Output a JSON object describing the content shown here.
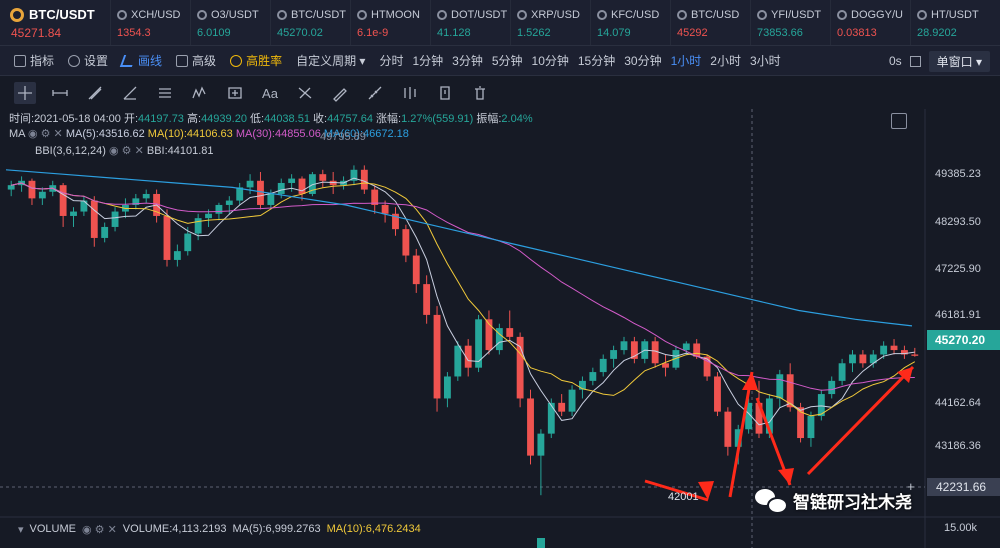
{
  "ticker": {
    "main": {
      "symbol": "BTC/USDT",
      "price": "45271.84"
    },
    "items": [
      {
        "symbol": "XCH/USD",
        "price": "1354.3",
        "dir": "down"
      },
      {
        "symbol": "O3/USDT",
        "price": "6.0109",
        "dir": "up"
      },
      {
        "symbol": "BTC/USDT",
        "price": "45270.02",
        "dir": "up"
      },
      {
        "symbol": "HTMOON",
        "price": "6.1e-9",
        "dir": "down"
      },
      {
        "symbol": "DOT/USDT",
        "price": "41.128",
        "dir": "up"
      },
      {
        "symbol": "XRP/USD",
        "price": "1.5262",
        "dir": "up"
      },
      {
        "symbol": "KFC/USD",
        "price": "14.079",
        "dir": "up"
      },
      {
        "symbol": "BTC/USD",
        "price": "45292",
        "dir": "down"
      },
      {
        "symbol": "YFI/USDT",
        "price": "73853.66",
        "dir": "up"
      },
      {
        "symbol": "DOGGY/U",
        "price": "0.03813",
        "dir": "down"
      },
      {
        "symbol": "HT/USDT",
        "price": "28.9202",
        "dir": "up"
      }
    ]
  },
  "toolbar": {
    "indicators": "指标",
    "settings": "设置",
    "draw": "画线",
    "advanced": "高级",
    "winrate": "高胜率",
    "custom_period": "自定义周期 ▾",
    "timeframes": [
      "分时",
      "1分钟",
      "3分钟",
      "5分钟",
      "10分钟",
      "15分钟",
      "30分钟",
      "1小时",
      "2小时",
      "3小时"
    ],
    "active_timeframe": "1小时",
    "zero_s": "0s",
    "window_select": "单窗口 ▾"
  },
  "drawtools": [
    "crosshair",
    "hline",
    "ray",
    "trend",
    "channel",
    "wave",
    "rect",
    "text",
    "fib",
    "brush",
    "measure",
    "pattern",
    "clock",
    "delete"
  ],
  "info": {
    "line1": {
      "time_label": "时间:",
      "time": "2021-05-18 04:00",
      "open_label": "开:",
      "open": "44197.73",
      "high_label": "高:",
      "high": "44939.20",
      "low_label": "低:",
      "low": "44038.51",
      "close_label": "收:",
      "close": "44757.64",
      "chg_label": "涨幅:",
      "chg": "1.27%(559.91)",
      "amp_label": "振幅:",
      "amp": "2.04%"
    },
    "ma_line": {
      "name": "MA",
      "ma5": "MA(5):43516.62",
      "ma10": "MA(10):44106.63",
      "ma30": "MA(30):44855.06",
      "ma60": "MA(60):46672.18"
    },
    "bbi_line": {
      "name": "BBI(3,6,12,24)",
      "bbi": "BBI:44101.81"
    },
    "overlay_high_label": "49795.89",
    "low_label": "42001"
  },
  "price_axis": {
    "ticks": [
      "49385.23",
      "48293.50",
      "47225.90",
      "46181.91",
      "44162.64",
      "43186.36",
      "42231.66"
    ],
    "current_price": "45270.20",
    "vol_tick": "15.00k"
  },
  "volume": {
    "name": "VOLUME",
    "volume": "VOLUME:4,113.2193",
    "ma5": "MA(5):6,999.2763",
    "ma10": "MA(10):6,476.2434"
  },
  "watermark": "智链研习社木尧",
  "colors": {
    "up": "#26a69a",
    "down": "#ef5350",
    "ma5": "#c9cfe0",
    "ma10": "#f0c93a",
    "ma30": "#d25bc9",
    "ma60": "#2c9fe0"
  },
  "chart_data": {
    "type": "candlestick",
    "ylim": [
      41900,
      50200
    ],
    "candles": [
      [
        49050,
        49250,
        48900,
        49150
      ],
      [
        49150,
        49350,
        49000,
        49250
      ],
      [
        49250,
        49300,
        48700,
        48850
      ],
      [
        48850,
        49100,
        48700,
        49000
      ],
      [
        49000,
        49250,
        48900,
        49150
      ],
      [
        49150,
        49200,
        48200,
        48450
      ],
      [
        48450,
        48650,
        48200,
        48550
      ],
      [
        48550,
        48900,
        48450,
        48800
      ],
      [
        48800,
        48900,
        47750,
        47950
      ],
      [
        47950,
        48300,
        47850,
        48200
      ],
      [
        48200,
        48650,
        48100,
        48550
      ],
      [
        48550,
        48850,
        48400,
        48700
      ],
      [
        48700,
        48950,
        48600,
        48850
      ],
      [
        48850,
        49050,
        48750,
        48950
      ],
      [
        48950,
        49050,
        48300,
        48450
      ],
      [
        48450,
        48600,
        47300,
        47450
      ],
      [
        47450,
        47800,
        47300,
        47650
      ],
      [
        47650,
        48200,
        47550,
        48050
      ],
      [
        48050,
        48500,
        47900,
        48400
      ],
      [
        48400,
        48600,
        48200,
        48500
      ],
      [
        48500,
        48750,
        48350,
        48700
      ],
      [
        48700,
        48900,
        48500,
        48800
      ],
      [
        48800,
        49200,
        48700,
        49100
      ],
      [
        49100,
        49400,
        48950,
        49250
      ],
      [
        49250,
        49450,
        48600,
        48700
      ],
      [
        48700,
        49050,
        48600,
        48950
      ],
      [
        48950,
        49300,
        48850,
        49200
      ],
      [
        49200,
        49400,
        49000,
        49300
      ],
      [
        49300,
        49350,
        48800,
        48950
      ],
      [
        48950,
        49450,
        48900,
        49400
      ],
      [
        49400,
        49500,
        49100,
        49250
      ],
      [
        49250,
        49450,
        48950,
        49150
      ],
      [
        49150,
        49350,
        49050,
        49250
      ],
      [
        49250,
        49600,
        49150,
        49500
      ],
      [
        49500,
        49600,
        48950,
        49050
      ],
      [
        49050,
        49150,
        48500,
        48700
      ],
      [
        48700,
        48800,
        48300,
        48500
      ],
      [
        48500,
        48650,
        48000,
        48150
      ],
      [
        48150,
        48250,
        47400,
        47550
      ],
      [
        47550,
        47700,
        46700,
        46900
      ],
      [
        46900,
        47100,
        46000,
        46200
      ],
      [
        46200,
        46400,
        44000,
        44300
      ],
      [
        44300,
        44900,
        44100,
        44800
      ],
      [
        44800,
        45600,
        44700,
        45500
      ],
      [
        45500,
        45650,
        44800,
        45000
      ],
      [
        45000,
        46200,
        44900,
        46100
      ],
      [
        46100,
        46300,
        45300,
        45400
      ],
      [
        45400,
        46000,
        45300,
        45900
      ],
      [
        45900,
        46300,
        45600,
        45700
      ],
      [
        45700,
        45800,
        44100,
        44300
      ],
      [
        44300,
        44500,
        42800,
        43000
      ],
      [
        43000,
        43600,
        42100,
        43500
      ],
      [
        43500,
        44300,
        43400,
        44200
      ],
      [
        44200,
        44400,
        43900,
        44000
      ],
      [
        44000,
        44600,
        43900,
        44500
      ],
      [
        44500,
        44800,
        44300,
        44700
      ],
      [
        44700,
        45000,
        44600,
        44900
      ],
      [
        44900,
        45300,
        44800,
        45200
      ],
      [
        45200,
        45500,
        45000,
        45400
      ],
      [
        45400,
        45700,
        45300,
        45600
      ],
      [
        45600,
        45700,
        45100,
        45200
      ],
      [
        45200,
        45650,
        45100,
        45600
      ],
      [
        45600,
        45700,
        45000,
        45100
      ],
      [
        45100,
        45300,
        44800,
        45000
      ],
      [
        45000,
        45500,
        44950,
        45400
      ],
      [
        45400,
        45600,
        45300,
        45550
      ],
      [
        45550,
        45650,
        45200,
        45250
      ],
      [
        45250,
        45300,
        44700,
        44800
      ],
      [
        44800,
        44900,
        43900,
        44000
      ],
      [
        44000,
        44100,
        43000,
        43200
      ],
      [
        43200,
        43700,
        42800,
        43600
      ],
      [
        43600,
        44300,
        43500,
        44200
      ],
      [
        44200,
        44700,
        43400,
        43500
      ],
      [
        43500,
        44400,
        43400,
        44300
      ],
      [
        44300,
        44950,
        44100,
        44850
      ],
      [
        44850,
        45100,
        44000,
        44100
      ],
      [
        44100,
        44200,
        43300,
        43400
      ],
      [
        43400,
        44000,
        43200,
        43900
      ],
      [
        43900,
        44500,
        43800,
        44400
      ],
      [
        44400,
        44800,
        44300,
        44700
      ],
      [
        44700,
        45200,
        44600,
        45100
      ],
      [
        45100,
        45400,
        44900,
        45300
      ],
      [
        45300,
        45400,
        45000,
        45100
      ],
      [
        45100,
        45400,
        45000,
        45300
      ],
      [
        45300,
        45600,
        45200,
        45500
      ],
      [
        45500,
        45650,
        45300,
        45400
      ],
      [
        45400,
        45500,
        45200,
        45300
      ],
      [
        45300,
        45450,
        45250,
        45270
      ]
    ],
    "ma_periods": [
      5,
      10,
      30,
      60
    ],
    "ma60_line": [
      49500,
      49400,
      49300,
      49200,
      49100,
      48900,
      48700,
      48400,
      48100,
      47800,
      47500,
      47200,
      46900,
      46600,
      46300,
      46100,
      45950
    ]
  }
}
